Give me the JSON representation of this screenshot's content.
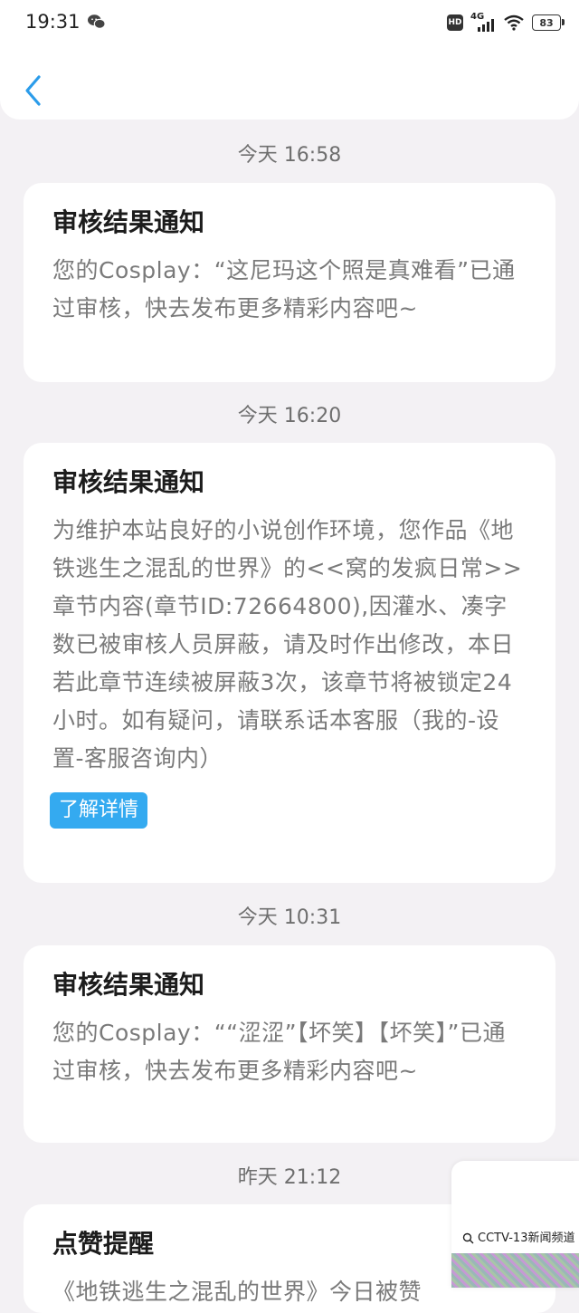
{
  "status_bar": {
    "time": "19:31",
    "hd": "HD",
    "network": "4G",
    "battery": "83"
  },
  "notifications": [
    {
      "time": "今天 16:58",
      "title": "审核结果通知",
      "body": "您的Cosplay：“这尼玛这个照是真难看”已通过审核，快去发布更多精彩内容吧~"
    },
    {
      "time": "今天 16:20",
      "title": "审核结果通知",
      "body": "为维护本站良好的小说创作环境，您作品《地铁逃生之混乱的世界》的<<窝的发疯日常>>章节内容(章节ID:72664800),因灌水、凑字数已被审核人员屏蔽，请及时作出修改，本日若此章节连续被屏蔽3次，该章节将被锁定24小时。如有疑问，请联系话本客服（我的-设置-客服咨询内）",
      "button": "了解详情"
    },
    {
      "time": "今天 10:31",
      "title": "审核结果通知",
      "body": "您的Cosplay：““涩涩”【坏笑】【坏笑】”已通过审核，快去发布更多精彩内容吧~"
    },
    {
      "time": "昨天 21:12",
      "title": "点赞提醒",
      "body": "《地铁逃生之混乱的世界》今日被赞"
    }
  ],
  "floating_widget": {
    "text": "CCTV-13新闻频道"
  }
}
